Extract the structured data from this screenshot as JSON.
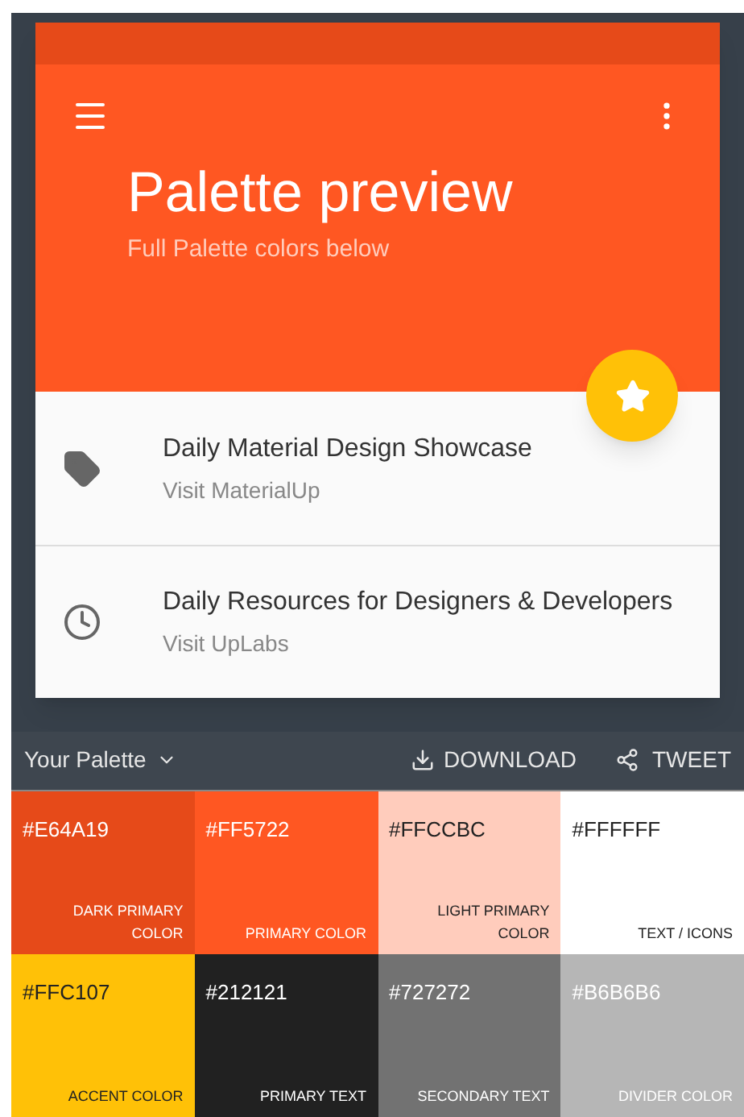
{
  "app_bar": {
    "title": "Palette preview",
    "subtitle": "Full Palette colors below"
  },
  "list": [
    {
      "kind": "label",
      "title": "Daily Material Design Showcase",
      "subtitle": "Visit MaterialUp"
    },
    {
      "kind": "clock",
      "title": "Daily Resources for Designers & Developers",
      "subtitle": "Visit UpLabs"
    }
  ],
  "toolbar": {
    "palette_menu": "Your Palette",
    "download": "DOWNLOAD",
    "tweet": "TWEET"
  },
  "swatches": [
    {
      "hex": "#E64A19",
      "label": "DARK PRIMARY COLOR",
      "color": "#e64a19"
    },
    {
      "hex": "#FF5722",
      "label": "PRIMARY COLOR",
      "color": "#ff5722"
    },
    {
      "hex": "#FFCCBC",
      "label": "LIGHT PRIMARY COLOR",
      "color": "#ffccbc"
    },
    {
      "hex": "#FFFFFF",
      "label": "TEXT / ICONS",
      "color": "#ffffff"
    },
    {
      "hex": "#FFC107",
      "label": "ACCENT COLOR",
      "color": "#ffc107"
    },
    {
      "hex": "#212121",
      "label": "PRIMARY TEXT",
      "color": "#212121"
    },
    {
      "hex": "#727272",
      "label": "SECONDARY TEXT",
      "color": "#727272"
    },
    {
      "hex": "#B6B6B6",
      "label": "DIVIDER COLOR",
      "color": "#b6b6b6"
    }
  ]
}
